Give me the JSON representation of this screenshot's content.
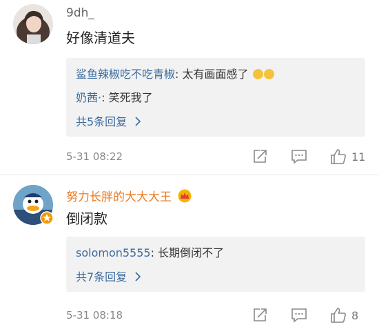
{
  "comments": [
    {
      "username": "9dh_",
      "username_color": "#666666",
      "text": "好像清道夫",
      "replies": [
        {
          "author": "鲨鱼辣椒吃不吃青椒",
          "text": "太有画面感了"
        },
        {
          "author": "奶茜·",
          "text": "笑死我了"
        }
      ],
      "more_label": "共5条回复",
      "time": "5-31 08:22",
      "likes": "11"
    },
    {
      "username": "努力长胖的大大大王",
      "username_color": "#ec7a1f",
      "text": "倒闭款",
      "replies": [
        {
          "author": "solomon5555",
          "text": "长期倒闭不了"
        }
      ],
      "more_label": "共7条回复",
      "time": "5-31 08:18",
      "likes": "8"
    }
  ],
  "icons": {
    "repost": "repost-icon",
    "comment": "comment-icon",
    "like": "thumbs-up-icon",
    "chevron": "chevron-right-icon",
    "crown": "crown-badge-icon",
    "verified": "verified-badge-icon"
  },
  "colors": {
    "reply_author": "#3a6a9e",
    "vip_name": "#ec7a1f",
    "verified_badge": "#f39800"
  }
}
